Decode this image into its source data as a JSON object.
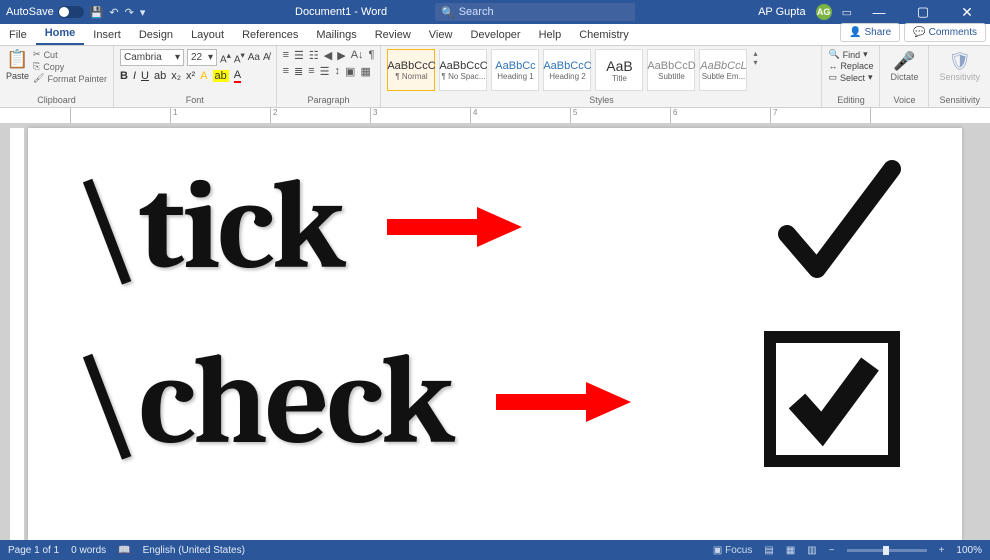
{
  "titlebar": {
    "autosave": "AutoSave",
    "doc_title": "Document1 - Word",
    "search_placeholder": "Search",
    "user_name": "AP Gupta",
    "user_initials": "AG"
  },
  "tabs": {
    "items": [
      "File",
      "Home",
      "Insert",
      "Design",
      "Layout",
      "References",
      "Mailings",
      "Review",
      "View",
      "Developer",
      "Help",
      "Chemistry"
    ],
    "active_index": 1,
    "share": "Share",
    "comments": "Comments"
  },
  "ribbon": {
    "clipboard": {
      "label": "Clipboard",
      "paste": "Paste",
      "cut": "Cut",
      "copy": "Copy",
      "format_painter": "Format Painter"
    },
    "font": {
      "label": "Font",
      "name": "Cambria",
      "size": "22"
    },
    "paragraph": {
      "label": "Paragraph"
    },
    "styles": {
      "label": "Styles",
      "items": [
        {
          "preview": "AaBbCcC",
          "name": "¶ Normal"
        },
        {
          "preview": "AaBbCcC",
          "name": "¶ No Spac..."
        },
        {
          "preview": "AaBbCc",
          "name": "Heading 1"
        },
        {
          "preview": "AaBbCcC",
          "name": "Heading 2"
        },
        {
          "preview": "AaB",
          "name": "Title"
        },
        {
          "preview": "AaBbCcD",
          "name": "Subtitle"
        },
        {
          "preview": "AaBbCcL",
          "name": "Subtle Em..."
        }
      ]
    },
    "editing": {
      "label": "Editing",
      "find": "Find",
      "replace": "Replace",
      "select": "Select"
    },
    "voice": {
      "label": "Voice",
      "dictate": "Dictate"
    },
    "sensitivity": {
      "label": "Sensitivity",
      "btn": "Sensitivity"
    }
  },
  "ruler": {
    "marks": [
      "",
      "1",
      "2",
      "3",
      "4",
      "5",
      "6",
      "7",
      ""
    ]
  },
  "document": {
    "rows": [
      {
        "text": "\\tick",
        "result_type": "tick"
      },
      {
        "text": "\\check",
        "result_type": "checkbox"
      }
    ]
  },
  "statusbar": {
    "page": "Page 1 of 1",
    "words": "0 words",
    "lang": "English (United States)",
    "focus": "Focus",
    "zoom": "100%"
  }
}
